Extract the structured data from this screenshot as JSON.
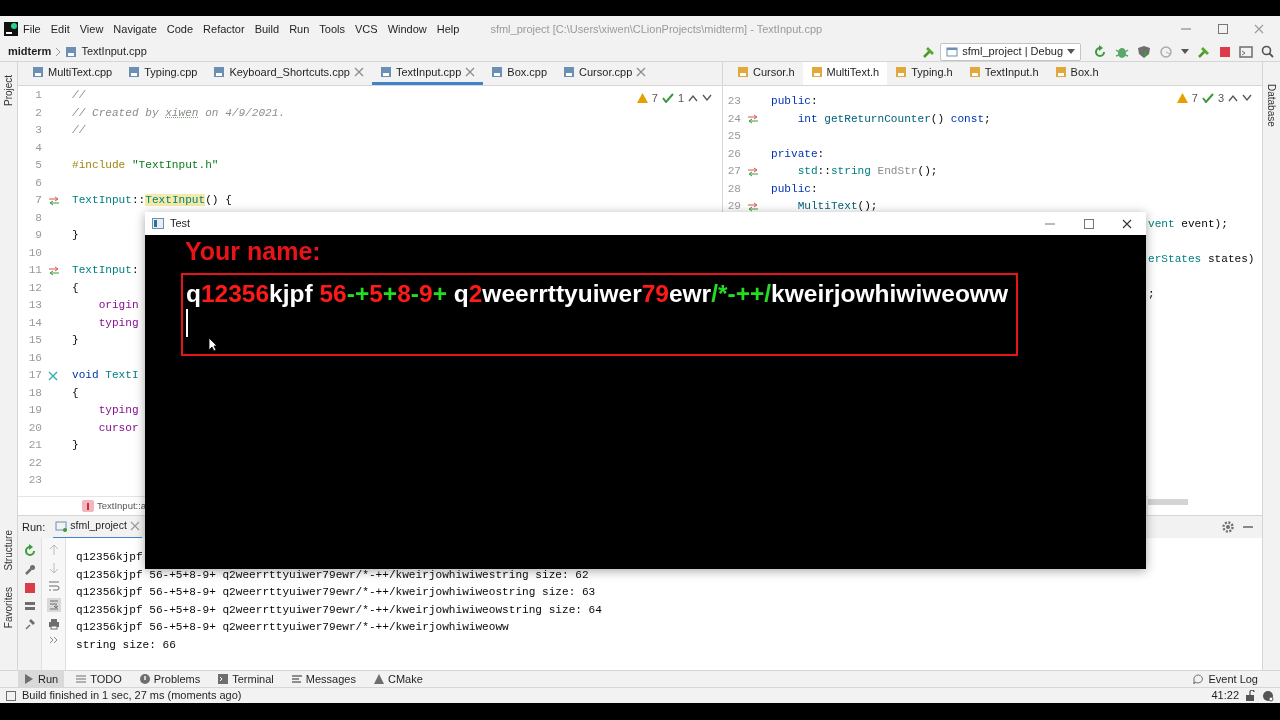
{
  "ide_window": {
    "menu": [
      "File",
      "Edit",
      "View",
      "Navigate",
      "Code",
      "Refactor",
      "Build",
      "Run",
      "Tools",
      "VCS",
      "Window",
      "Help"
    ],
    "title": "sfml_project [C:\\Users\\xiwen\\CLionProjects\\midterm] - TextInput.cpp"
  },
  "navigation_bar": {
    "breadcrumb": [
      "midterm",
      "TextInput.cpp"
    ],
    "run_configuration": "sfml_project | Debug"
  },
  "tool_strips": {
    "left": [
      "Project",
      "Structure",
      "Favorites"
    ],
    "right": [
      "Database"
    ]
  },
  "left_editor": {
    "tabs": [
      {
        "label": "MultiText.cpp",
        "kind": "source",
        "selected": false,
        "closable": false
      },
      {
        "label": "Typing.cpp",
        "kind": "source",
        "selected": false,
        "closable": false
      },
      {
        "label": "Keyboard_Shortcuts.cpp",
        "kind": "source",
        "selected": false,
        "closable": true
      },
      {
        "label": "TextInput.cpp",
        "kind": "source",
        "selected": true,
        "closable": true
      },
      {
        "label": "Box.cpp",
        "kind": "source",
        "selected": false,
        "closable": false
      },
      {
        "label": "Cursor.cpp",
        "kind": "source",
        "selected": false,
        "closable": true
      }
    ],
    "inspections": {
      "warnings": "7",
      "checks": "1"
    },
    "lines": [
      {
        "number": "1",
        "code": [
          {
            "kind": "comment",
            "text": "//"
          }
        ]
      },
      {
        "number": "2",
        "code": [
          {
            "kind": "comment",
            "text": "// Created by "
          },
          {
            "kind": "typo",
            "text": "xiwen"
          },
          {
            "kind": "comment",
            "text": " on 4/9/2021."
          }
        ]
      },
      {
        "number": "3",
        "code": [
          {
            "kind": "comment",
            "text": "//"
          }
        ]
      },
      {
        "number": "4"
      },
      {
        "number": "5",
        "code": [
          {
            "kind": "macro",
            "text": "#include "
          },
          {
            "kind": "string",
            "text": "\"TextInput.h\""
          }
        ]
      },
      {
        "number": "6"
      },
      {
        "number": "7",
        "gutter": {
          "kind": "override"
        },
        "code": [
          {
            "kind": "type",
            "text": "TextInput"
          },
          {
            "kind": "plain",
            "text": "::"
          },
          {
            "kind": "highlight",
            "text": "TextInput"
          },
          {
            "kind": "plain",
            "text": "() {"
          }
        ]
      },
      {
        "number": "8"
      },
      {
        "number": "9",
        "code": [
          {
            "kind": "plain",
            "text": "}"
          }
        ]
      },
      {
        "number": "10"
      },
      {
        "number": "11",
        "gutter": {
          "kind": "override"
        },
        "code": [
          {
            "kind": "type",
            "text": "TextInput"
          },
          {
            "kind": "plain",
            "text": ":"
          }
        ]
      },
      {
        "number": "12",
        "code": [
          {
            "kind": "plain",
            "text": "{"
          }
        ]
      },
      {
        "number": "13",
        "code": [
          {
            "kind": "member",
            "text": "    origin"
          }
        ]
      },
      {
        "number": "14",
        "code": [
          {
            "kind": "member",
            "text": "    typing"
          }
        ]
      },
      {
        "number": "15",
        "code": [
          {
            "kind": "plain",
            "text": "}"
          }
        ]
      },
      {
        "number": "16"
      },
      {
        "number": "17",
        "gutter": {
          "kind": "unused"
        },
        "code": [
          {
            "kind": "keyword",
            "text": "void "
          },
          {
            "kind": "type",
            "text": "TextI"
          }
        ]
      },
      {
        "number": "18",
        "code": [
          {
            "kind": "plain",
            "text": "{"
          }
        ]
      },
      {
        "number": "19",
        "code": [
          {
            "kind": "member",
            "text": "    typing"
          }
        ]
      },
      {
        "number": "20",
        "code": [
          {
            "kind": "member",
            "text": "    cursor"
          }
        ]
      },
      {
        "number": "21",
        "code": [
          {
            "kind": "plain",
            "text": "}"
          }
        ]
      },
      {
        "number": "22"
      },
      {
        "number": "23"
      }
    ],
    "breadcrumb": "TextInput::a"
  },
  "right_editor": {
    "tabs": [
      {
        "label": "Cursor.h",
        "kind": "header",
        "selected": false,
        "closable": false
      },
      {
        "label": "MultiText.h",
        "kind": "header",
        "selected": true,
        "closable": false
      },
      {
        "label": "Typing.h",
        "kind": "header",
        "selected": false,
        "closable": false
      },
      {
        "label": "TextInput.h",
        "kind": "header",
        "selected": false,
        "closable": false
      },
      {
        "label": "Box.h",
        "kind": "header",
        "selected": false,
        "closable": false
      }
    ],
    "inspections": {
      "warnings": "7",
      "checks": "3"
    },
    "lines": [
      {
        "number": "23",
        "code": [
          {
            "kind": "keyword",
            "text": "public"
          },
          {
            "kind": "plain",
            "text": ":"
          }
        ]
      },
      {
        "number": "24",
        "gutter": {
          "kind": "override"
        },
        "code": [
          {
            "kind": "keyword",
            "text": "    int "
          },
          {
            "kind": "function",
            "text": "getReturnCounter"
          },
          {
            "kind": "plain",
            "text": "() "
          },
          {
            "kind": "keyword",
            "text": "const"
          },
          {
            "kind": "plain",
            "text": ";"
          }
        ]
      },
      {
        "number": "25"
      },
      {
        "number": "26",
        "code": [
          {
            "kind": "keyword",
            "text": "private"
          },
          {
            "kind": "plain",
            "text": ":"
          }
        ]
      },
      {
        "number": "27",
        "gutter": {
          "kind": "override"
        },
        "code": [
          {
            "kind": "type",
            "text": "    std"
          },
          {
            "kind": "plain",
            "text": "::"
          },
          {
            "kind": "type",
            "text": "string "
          },
          {
            "kind": "unused",
            "text": "EndStr"
          },
          {
            "kind": "plain",
            "text": "();"
          }
        ]
      },
      {
        "number": "28",
        "code": [
          {
            "kind": "keyword",
            "text": "public"
          },
          {
            "kind": "plain",
            "text": ":"
          }
        ]
      },
      {
        "number": "29",
        "gutter": {
          "kind": "override"
        },
        "code": [
          {
            "kind": "function",
            "text": "    MultiText"
          },
          {
            "kind": "plain",
            "text": "();"
          }
        ]
      }
    ],
    "tails": [
      {
        "code": [
          {
            "kind": "type",
            "text": "vent"
          },
          {
            "kind": "plain",
            "text": " event);"
          }
        ]
      },
      {
        "code": [
          {
            "kind": "type",
            "text": "erStates"
          },
          {
            "kind": "plain",
            "text": " states)"
          }
        ]
      },
      {
        "code": [
          {
            "kind": "plain",
            "text": ";"
          }
        ]
      }
    ]
  },
  "run_panel": {
    "label": "Run:",
    "tab": "sfml_project",
    "output": [
      "q12356kjpf",
      "q12356kjpf 56-+5+8-9+ q2weerrttyuiwer79ewr/*-++/kweirjowhiwiwestring size: 62",
      "q12356kjpf 56-+5+8-9+ q2weerrttyuiwer79ewr/*-++/kweirjowhiwiweostring size: 63",
      "q12356kjpf 56-+5+8-9+ q2weerrttyuiwer79ewr/*-++/kweirjowhiwiweowstring size: 64",
      "q12356kjpf 56-+5+8-9+ q2weerrttyuiwer79ewr/*-++/kweirjowhiwiweoww",
      "string size: 66"
    ]
  },
  "tool_tabs": [
    {
      "label": "Run",
      "kind": "run",
      "selected": true
    },
    {
      "label": "TODO",
      "kind": "list",
      "selected": false
    },
    {
      "label": "Problems",
      "kind": "problems",
      "selected": false
    },
    {
      "label": "Terminal",
      "kind": "terminal",
      "selected": false
    },
    {
      "label": "Messages",
      "kind": "messages",
      "selected": false
    },
    {
      "label": "CMake",
      "kind": "cmake",
      "selected": false
    }
  ],
  "event_log": "Event Log",
  "status_bar": {
    "message": "Build finished in 1 sec, 27 ms (moments ago)",
    "position": "41:22"
  },
  "test_window": {
    "title": "Test",
    "prompt": "Your name:",
    "input": [
      {
        "text": "q",
        "color": "#ffffff"
      },
      {
        "text": "12356",
        "color": "#ff1a1a"
      },
      {
        "text": "kjpf ",
        "color": "#ffffff"
      },
      {
        "text": "56",
        "color": "#ff1a1a"
      },
      {
        "text": "-+",
        "color": "#22dd22"
      },
      {
        "text": "5",
        "color": "#ff1a1a"
      },
      {
        "text": "+",
        "color": "#22dd22"
      },
      {
        "text": "8",
        "color": "#ff1a1a"
      },
      {
        "text": "-",
        "color": "#22dd22"
      },
      {
        "text": "9",
        "color": "#ff1a1a"
      },
      {
        "text": "+ ",
        "color": "#22dd22"
      },
      {
        "text": "q",
        "color": "#ffffff"
      },
      {
        "text": "2",
        "color": "#ff1a1a"
      },
      {
        "text": "weerrttyuiwer",
        "color": "#ffffff"
      },
      {
        "text": "79",
        "color": "#ff1a1a"
      },
      {
        "text": "ewr",
        "color": "#ffffff"
      },
      {
        "text": "/*-++/",
        "color": "#22dd22"
      },
      {
        "text": "kweirjowhiwiweoww",
        "color": "#ffffff"
      }
    ]
  }
}
